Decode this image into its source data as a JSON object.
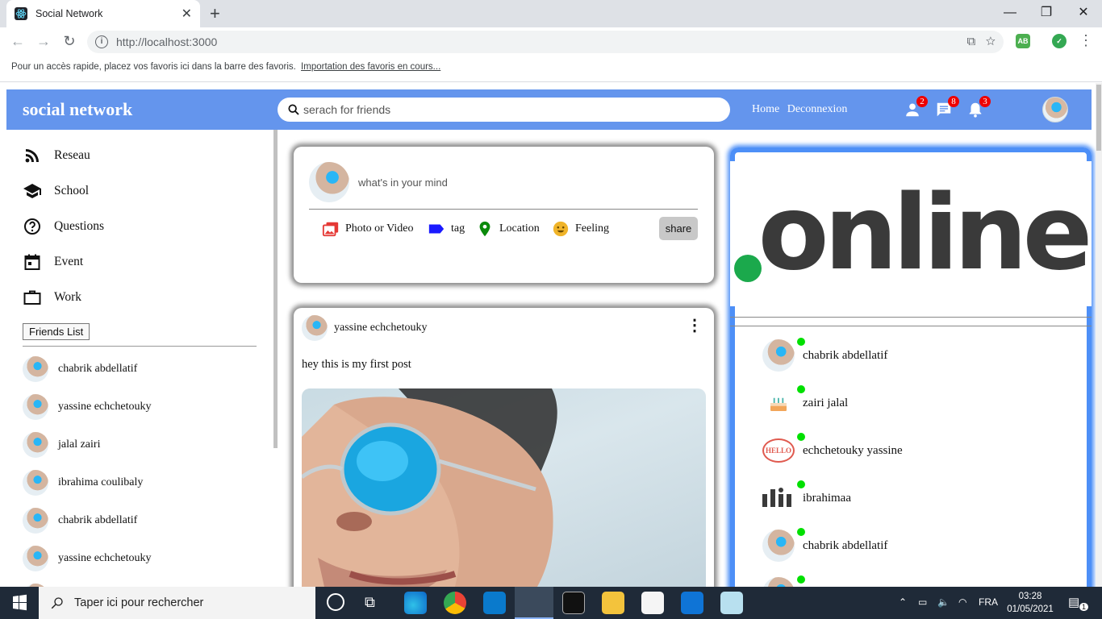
{
  "browser": {
    "tab_title": "Social Network",
    "url": "http://localhost:3000",
    "bookmarks_text": "Pour un accès rapide, placez vos favoris ici dans la barre des favoris.",
    "bookmarks_link": "Importation des favoris en cours..."
  },
  "header": {
    "brand": "social network",
    "search_placeholder": "serach for friends",
    "links": [
      "Home",
      "Deconnexion"
    ],
    "badges": {
      "friends": "2",
      "messages": "8",
      "notifications": "3"
    }
  },
  "sidebar": {
    "items": [
      {
        "label": "Reseau",
        "icon": "rss-icon"
      },
      {
        "label": "School",
        "icon": "school-icon"
      },
      {
        "label": "Questions",
        "icon": "help-circle-icon"
      },
      {
        "label": "Event",
        "icon": "calendar-icon"
      },
      {
        "label": "Work",
        "icon": "briefcase-icon"
      }
    ],
    "friends_button": "Friends List",
    "friends": [
      "chabrik abdellatif",
      "yassine echchetouky",
      "jalal zairi",
      "ibrahima coulibaly",
      "chabrik abdellatif",
      "yassine echchetouky"
    ]
  },
  "composer": {
    "placeholder": "what's in your mind",
    "options": [
      "Photo or Video",
      "tag",
      "Location",
      "Feeling"
    ],
    "share_label": "share"
  },
  "post": {
    "author": "yassine echchetouky",
    "text": "hey this is my first post"
  },
  "online": {
    "logo_text": "online",
    "users": [
      "chabrik abdellatif",
      "zairi jalal",
      "echchetouky yassine",
      "ibrahimaa",
      "chabrik abdellatif"
    ]
  },
  "taskbar": {
    "search_placeholder": "Taper ici pour rechercher",
    "language": "FRA",
    "time": "03:28",
    "date": "01/05/2021",
    "notification_count": "1"
  },
  "colors": {
    "header_bg": "#6495ed",
    "online_border": "#4d8ff7",
    "online_dot": "#00e000",
    "badge": "#ee0000"
  }
}
